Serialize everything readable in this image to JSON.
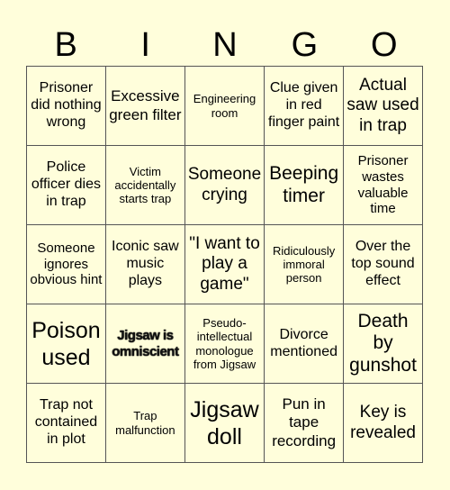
{
  "header": [
    "B",
    "I",
    "N",
    "G",
    "O"
  ],
  "cells": [
    "Prisoner did nothing wrong",
    "Excessive green filter",
    "Engineering room",
    "Clue given in red finger paint",
    "Actual saw used in trap",
    "Police officer dies in trap",
    "Victim accidentally starts trap",
    "Someone crying",
    "Beeping timer",
    "Prisoner wastes valuable time",
    "Someone ignores obvious hint",
    "Iconic saw music plays",
    "\"I want to play a game\"",
    "Ridiculously immoral person",
    "Over the top sound effect",
    "Poison used",
    "Jigsaw is omniscient",
    "Pseudo-intellectual monologue from Jigsaw",
    "Divorce mentioned",
    "Death by gunshot",
    "Trap not contained in plot",
    "Trap malfunction",
    "Jigsaw doll",
    "Pun in tape recording",
    "Key is revealed"
  ],
  "colors": {
    "background": "#fffedb",
    "grid_line": "#555555",
    "text": "#000000"
  }
}
